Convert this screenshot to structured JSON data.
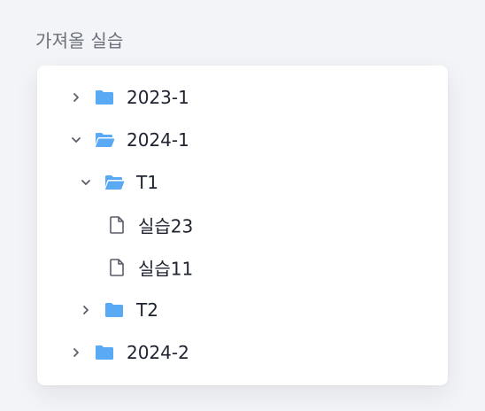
{
  "section": {
    "title": "가져올 실습"
  },
  "tree": [
    {
      "label": "2023-1",
      "type": "folder",
      "expanded": false,
      "depth": 0
    },
    {
      "label": "2024-1",
      "type": "folder",
      "expanded": true,
      "depth": 0
    },
    {
      "label": "T1",
      "type": "folder",
      "expanded": true,
      "depth": 1
    },
    {
      "label": "실습23",
      "type": "file",
      "depth": 2
    },
    {
      "label": "실습11",
      "type": "file",
      "depth": 2
    },
    {
      "label": "T2",
      "type": "folder",
      "expanded": false,
      "depth": 1
    },
    {
      "label": "2024-2",
      "type": "folder",
      "expanded": false,
      "depth": 0
    }
  ],
  "colors": {
    "folder": "#5aa9f5",
    "chevron": "#5b5f6b",
    "file_icon": "#595d68"
  }
}
